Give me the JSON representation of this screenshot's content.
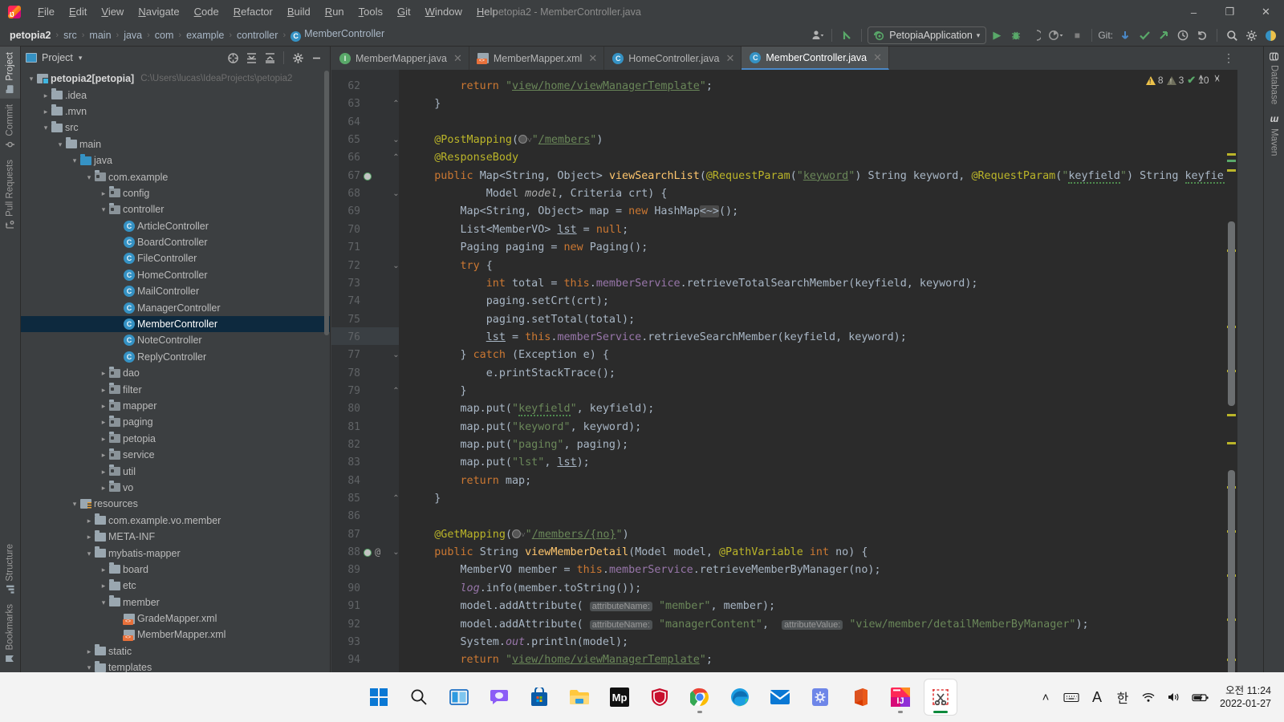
{
  "window": {
    "title": "petopia2 - MemberController.java",
    "minimize": "–",
    "maximize": "❐",
    "close": "✕"
  },
  "menubar": {
    "items": [
      {
        "label": "File",
        "mnemonic": "F"
      },
      {
        "label": "Edit",
        "mnemonic": "E"
      },
      {
        "label": "View",
        "mnemonic": "V"
      },
      {
        "label": "Navigate",
        "mnemonic": "N"
      },
      {
        "label": "Code",
        "mnemonic": "C"
      },
      {
        "label": "Refactor",
        "mnemonic": "R"
      },
      {
        "label": "Build",
        "mnemonic": "B"
      },
      {
        "label": "Run",
        "mnemonic": "R"
      },
      {
        "label": "Tools",
        "mnemonic": "T"
      },
      {
        "label": "Git",
        "mnemonic": "G"
      },
      {
        "label": "Window",
        "mnemonic": "W"
      },
      {
        "label": "Help",
        "mnemonic": "H"
      }
    ]
  },
  "breadcrumbs": {
    "separator": "›",
    "items": [
      {
        "label": "petopia2",
        "icon": ""
      },
      {
        "label": "src",
        "icon": ""
      },
      {
        "label": "main",
        "icon": ""
      },
      {
        "label": "java",
        "icon": ""
      },
      {
        "label": "com",
        "icon": ""
      },
      {
        "label": "example",
        "icon": ""
      },
      {
        "label": "controller",
        "icon": ""
      },
      {
        "label": "MemberController",
        "icon": "class-icon"
      }
    ]
  },
  "toolbar": {
    "profile_icon": "user-icon",
    "updates_icon": "up-arrow-icon",
    "run_config": "PetopiaApplication",
    "run_config_caret": "▾",
    "run_icon": "▶",
    "debug_icon": "debug-icon",
    "coverage_icon": "coverage-icon",
    "profiler_icon": "profiler-icon",
    "stop_icon": "■",
    "git_label": "Git:",
    "git_update_icon": "update-project-icon",
    "git_commit_icon": "commit-icon",
    "git_push_icon": "push-icon",
    "history_icon": "clock-icon",
    "undo_icon": "undo-icon",
    "search_icon": "search-icon",
    "settings_icon": "gear-icon",
    "ide_icon": "ide-icon"
  },
  "left_tool_strip": {
    "top": [
      {
        "label": "Project",
        "icon": "project-icon",
        "active": true
      },
      {
        "label": "Commit",
        "icon": "commit-icon",
        "active": false
      },
      {
        "label": "Pull Requests",
        "icon": "pull-request-icon",
        "active": false
      }
    ],
    "bottom": [
      {
        "label": "Structure",
        "icon": "structure-icon",
        "active": false
      },
      {
        "label": "Bookmarks",
        "icon": "bookmark-icon",
        "active": false
      }
    ]
  },
  "right_tool_strip": {
    "items": [
      {
        "label": "Database",
        "icon": "database-icon"
      },
      {
        "label": "Maven",
        "icon": "maven-icon"
      }
    ]
  },
  "project_panel": {
    "title": "Project",
    "caret": "▾",
    "actions": [
      {
        "name": "select-opened-file-icon",
        "glyph": "⊕"
      },
      {
        "name": "expand-all-icon",
        "glyph": "⧉"
      },
      {
        "name": "collapse-all-icon",
        "glyph": "⧈"
      },
      {
        "name": "settings-icon",
        "glyph": "⚙"
      },
      {
        "name": "hide-icon",
        "glyph": "—"
      }
    ],
    "tree": [
      {
        "depth": 0,
        "twist": "⌄",
        "icon": "module",
        "label": "petopia2",
        "bold_label": "[petopia]",
        "path": "C:\\Users\\lucas\\IdeaProjects\\petopia2",
        "selected": false
      },
      {
        "depth": 1,
        "twist": "›",
        "icon": "folder",
        "label": ".idea",
        "selected": false
      },
      {
        "depth": 1,
        "twist": "›",
        "icon": "folder",
        "label": ".mvn",
        "selected": false
      },
      {
        "depth": 1,
        "twist": "⌄",
        "icon": "folder",
        "label": "src",
        "selected": false
      },
      {
        "depth": 2,
        "twist": "⌄",
        "icon": "folder",
        "label": "main",
        "selected": false
      },
      {
        "depth": 3,
        "twist": "⌄",
        "icon": "folder-src",
        "label": "java",
        "selected": false
      },
      {
        "depth": 4,
        "twist": "⌄",
        "icon": "package",
        "label": "com.example",
        "selected": false
      },
      {
        "depth": 5,
        "twist": "›",
        "icon": "package",
        "label": "config",
        "selected": false
      },
      {
        "depth": 5,
        "twist": "⌄",
        "icon": "package",
        "label": "controller",
        "selected": false
      },
      {
        "depth": 6,
        "twist": "",
        "icon": "class",
        "label": "ArticleController",
        "selected": false
      },
      {
        "depth": 6,
        "twist": "",
        "icon": "class",
        "label": "BoardController",
        "selected": false
      },
      {
        "depth": 6,
        "twist": "",
        "icon": "class",
        "label": "FileController",
        "selected": false
      },
      {
        "depth": 6,
        "twist": "",
        "icon": "class",
        "label": "HomeController",
        "selected": false
      },
      {
        "depth": 6,
        "twist": "",
        "icon": "class",
        "label": "MailController",
        "selected": false
      },
      {
        "depth": 6,
        "twist": "",
        "icon": "class",
        "label": "ManagerController",
        "selected": false
      },
      {
        "depth": 6,
        "twist": "",
        "icon": "class",
        "label": "MemberController",
        "selected": true
      },
      {
        "depth": 6,
        "twist": "",
        "icon": "class",
        "label": "NoteController",
        "selected": false
      },
      {
        "depth": 6,
        "twist": "",
        "icon": "class",
        "label": "ReplyController",
        "selected": false
      },
      {
        "depth": 5,
        "twist": "›",
        "icon": "package",
        "label": "dao",
        "selected": false
      },
      {
        "depth": 5,
        "twist": "›",
        "icon": "package",
        "label": "filter",
        "selected": false
      },
      {
        "depth": 5,
        "twist": "›",
        "icon": "package",
        "label": "mapper",
        "selected": false
      },
      {
        "depth": 5,
        "twist": "›",
        "icon": "package",
        "label": "paging",
        "selected": false
      },
      {
        "depth": 5,
        "twist": "›",
        "icon": "package",
        "label": "petopia",
        "selected": false
      },
      {
        "depth": 5,
        "twist": "›",
        "icon": "package",
        "label": "service",
        "selected": false
      },
      {
        "depth": 5,
        "twist": "›",
        "icon": "package",
        "label": "util",
        "selected": false
      },
      {
        "depth": 5,
        "twist": "›",
        "icon": "package",
        "label": "vo",
        "selected": false
      },
      {
        "depth": 3,
        "twist": "⌄",
        "icon": "resources",
        "label": "resources",
        "selected": false
      },
      {
        "depth": 4,
        "twist": "›",
        "icon": "folder",
        "label": "com.example.vo.member",
        "selected": false
      },
      {
        "depth": 4,
        "twist": "›",
        "icon": "folder",
        "label": "META-INF",
        "selected": false
      },
      {
        "depth": 4,
        "twist": "⌄",
        "icon": "folder",
        "label": "mybatis-mapper",
        "selected": false
      },
      {
        "depth": 5,
        "twist": "›",
        "icon": "folder",
        "label": "board",
        "selected": false
      },
      {
        "depth": 5,
        "twist": "›",
        "icon": "folder",
        "label": "etc",
        "selected": false
      },
      {
        "depth": 5,
        "twist": "⌄",
        "icon": "folder",
        "label": "member",
        "selected": false
      },
      {
        "depth": 6,
        "twist": "",
        "icon": "xml",
        "label": "GradeMapper.xml",
        "selected": false
      },
      {
        "depth": 6,
        "twist": "",
        "icon": "xml",
        "label": "MemberMapper.xml",
        "selected": false
      },
      {
        "depth": 4,
        "twist": "›",
        "icon": "folder",
        "label": "static",
        "selected": false
      },
      {
        "depth": 4,
        "twist": "⌄",
        "icon": "folder",
        "label": "templates",
        "selected": false
      }
    ]
  },
  "editor": {
    "tabs": [
      {
        "label": "MemberMapper.java",
        "icon": "interface",
        "active": false,
        "close": "✕"
      },
      {
        "label": "MemberMapper.xml",
        "icon": "xml",
        "active": false,
        "close": "✕"
      },
      {
        "label": "HomeController.java",
        "icon": "class",
        "active": false,
        "close": "✕"
      },
      {
        "label": "MemberController.java",
        "icon": "class",
        "active": true,
        "close": "✕"
      }
    ],
    "more_tabs_icon": "⋮",
    "inspections": {
      "warnings": "8",
      "weak_warnings": "3",
      "typos": "10",
      "typo_icon": "✔",
      "collapse_icon": "˄"
    },
    "nav_up": "˄",
    "nav_down": "˅",
    "first_line_number": 62,
    "lines": [
      {
        "n": 62,
        "fold": "",
        "text": "        return \"view/home/viewManagerTemplate\";"
      },
      {
        "n": 63,
        "fold": "⬓",
        "text": "    }"
      },
      {
        "n": 64,
        "fold": "",
        "text": ""
      },
      {
        "n": 65,
        "fold": "⬓",
        "text": "    @PostMapping(\"/members\")"
      },
      {
        "n": 66,
        "fold": "⬓",
        "text": "    @ResponseBody"
      },
      {
        "n": 67,
        "fold": "",
        "text": "    public Map<String, Object> viewSearchList(@RequestParam(\"keyword\") String keyword, @RequestParam(\"keyfield\") String keyfield,"
      },
      {
        "n": 68,
        "fold": "⬓",
        "text": "            Model model, Criteria crt) {"
      },
      {
        "n": 69,
        "fold": "",
        "text": "        Map<String, Object> map = new HashMap<>();"
      },
      {
        "n": 70,
        "fold": "",
        "text": "        List<MemberVO> lst = null;"
      },
      {
        "n": 71,
        "fold": "",
        "text": "        Paging paging = new Paging();"
      },
      {
        "n": 72,
        "fold": "⬓",
        "text": "        try {"
      },
      {
        "n": 73,
        "fold": "",
        "text": "            int total = this.memberService.retrieveTotalSearchMember(keyfield, keyword);"
      },
      {
        "n": 74,
        "fold": "",
        "text": "            paging.setCrt(crt);"
      },
      {
        "n": 75,
        "fold": "",
        "text": "            paging.setTotal(total);"
      },
      {
        "n": 76,
        "fold": "",
        "text": "            lst = this.memberService.retrieveSearchMember(keyfield, keyword);"
      },
      {
        "n": 77,
        "fold": "⬓",
        "text": "        } catch (Exception e) {"
      },
      {
        "n": 78,
        "fold": "",
        "text": "            e.printStackTrace();"
      },
      {
        "n": 79,
        "fold": "⬓",
        "text": "        }"
      },
      {
        "n": 80,
        "fold": "",
        "text": "        map.put(\"keyfield\", keyfield);"
      },
      {
        "n": 81,
        "fold": "",
        "text": "        map.put(\"keyword\", keyword);"
      },
      {
        "n": 82,
        "fold": "",
        "text": "        map.put(\"paging\", paging);"
      },
      {
        "n": 83,
        "fold": "",
        "text": "        map.put(\"lst\", lst);"
      },
      {
        "n": 84,
        "fold": "",
        "text": "        return map;"
      },
      {
        "n": 85,
        "fold": "⬓",
        "text": "    }"
      },
      {
        "n": 86,
        "fold": "",
        "text": ""
      },
      {
        "n": 87,
        "fold": "",
        "text": "    @GetMapping(\"/members/{no}\")"
      },
      {
        "n": 88,
        "fold": "⬓",
        "text": "    public String viewMemberDetail(Model model, @PathVariable int no) {"
      },
      {
        "n": 89,
        "fold": "",
        "text": "        MemberVO member = this.memberService.retrieveMemberByManager(no);"
      },
      {
        "n": 90,
        "fold": "",
        "text": "        log.info(member.toString());"
      },
      {
        "n": 91,
        "fold": "",
        "text": "        model.addAttribute( attributeName: \"member\", member);"
      },
      {
        "n": 92,
        "fold": "",
        "text": "        model.addAttribute( attributeName: \"managerContent\",  attributeValue: \"view/member/detailMemberByManager\");"
      },
      {
        "n": 93,
        "fold": "",
        "text": "        System.out.println(model);"
      },
      {
        "n": 94,
        "fold": "",
        "text": "        return \"view/home/viewManagerTemplate\";"
      }
    ],
    "gutter_icons": [
      {
        "line": 67,
        "name": "spring-bean-icon"
      },
      {
        "line": 88,
        "name": "spring-bean-icon"
      },
      {
        "line": 88,
        "name": "annotation-icon",
        "glyph": "@"
      }
    ]
  },
  "taskbar": {
    "apps": [
      {
        "name": "start-button",
        "label": "Start"
      },
      {
        "name": "search-icon",
        "label": "Search"
      },
      {
        "name": "task-view-icon",
        "label": "Task View"
      },
      {
        "name": "chat-icon",
        "label": "Chat"
      },
      {
        "name": "microsoft-store-icon",
        "label": "Microsoft Store"
      },
      {
        "name": "file-explorer-icon",
        "label": "File Explorer"
      },
      {
        "name": "mp-icon",
        "label": "MP"
      },
      {
        "name": "shield-icon",
        "label": "Security"
      },
      {
        "name": "chrome-icon",
        "label": "Google Chrome"
      },
      {
        "name": "edge-icon",
        "label": "Microsoft Edge"
      },
      {
        "name": "mail-icon",
        "label": "Mail"
      },
      {
        "name": "settings-app-icon",
        "label": "Settings"
      },
      {
        "name": "office-icon",
        "label": "Office"
      },
      {
        "name": "intellij-idea-icon",
        "label": "IntelliJ IDEA"
      },
      {
        "name": "snipping-tool-icon",
        "label": "Snipping Tool"
      }
    ],
    "tray": {
      "overflow": "˄",
      "keyboard_icon": "keyboard-icon",
      "ime_latin": "A",
      "ime_hangul": "한",
      "wifi_icon": "wifi-icon",
      "volume_icon": "volume-icon",
      "battery_icon": "battery-icon",
      "time": "오전 11:24",
      "date": "2022-01-27"
    }
  },
  "colors": {
    "editor_bg": "#2b2b2b",
    "panel_bg": "#3c3f41",
    "gutter_bg": "#313335",
    "accent_blue": "#3592c4",
    "selection_blue": "#0d293e",
    "keyword_orange": "#cc7832",
    "string_green": "#6a8759",
    "annotation_yellow": "#bbb529",
    "field_purple": "#9876aa",
    "method_gold": "#ffc66d",
    "run_green": "#59a869"
  }
}
